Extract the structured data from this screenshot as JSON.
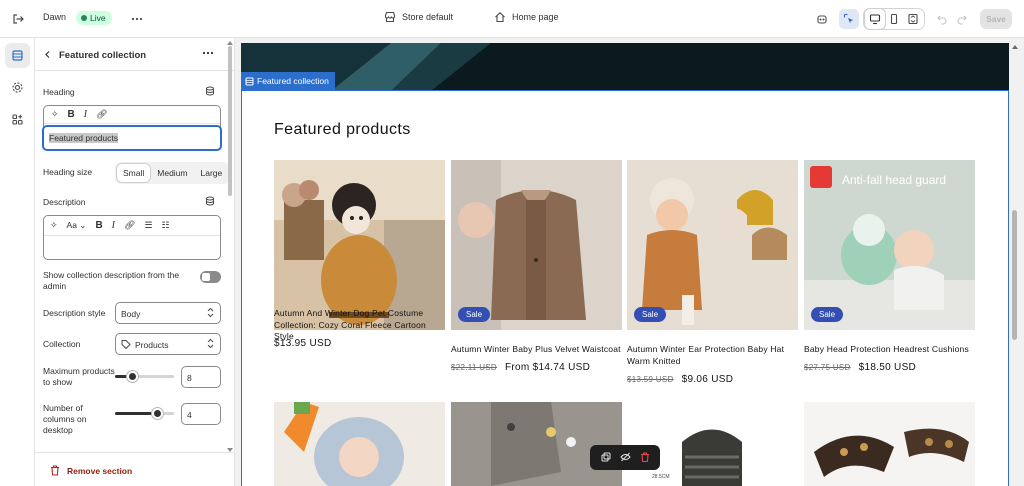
{
  "topbar": {
    "theme_name": "Dawn",
    "live_label": "Live",
    "store_label": "Store default",
    "page_label": "Home page",
    "save_label": "Save"
  },
  "panel": {
    "title": "Featured collection",
    "heading_label": "Heading",
    "heading_value": "Featured products",
    "heading_size_label": "Heading size",
    "size_options": [
      "Small",
      "Medium",
      "Large"
    ],
    "size_selected": "Small",
    "description_label": "Description",
    "show_desc_label": "Show collection description from the admin",
    "desc_style_label": "Description style",
    "desc_style_value": "Body",
    "collection_label": "Collection",
    "collection_value": "Products",
    "max_products_label": "Maximum products to show",
    "max_products_value": "8",
    "columns_label": "Number of columns on desktop",
    "columns_value": "4",
    "remove_label": "Remove section"
  },
  "preview": {
    "section_tag": "Featured collection",
    "heading": "Featured products",
    "products": [
      {
        "title": "Autumn And Winter Dog Pet Costume Collection: Cozy Coral Fleece Cartoon Style",
        "old_price": "",
        "price": "$13.95 USD",
        "sale": ""
      },
      {
        "title": "Autumn Winter Baby Plus Velvet Waistcoat",
        "old_price": "$22.11 USD",
        "price": "From $14.74 USD",
        "sale": "Sale"
      },
      {
        "title": "Autumn Winter Ear Protection Baby Hat Warm Knitted",
        "old_price": "$13.59 USD",
        "price": "$9.06 USD",
        "sale": "Sale"
      },
      {
        "title": "Baby Head Protection Headrest Cushions",
        "old_price": "$27.75 USD",
        "price": "$18.50 USD",
        "sale": "Sale"
      }
    ],
    "image4_text": "Anti-fall head guard",
    "image7_text": "28.5CM"
  }
}
